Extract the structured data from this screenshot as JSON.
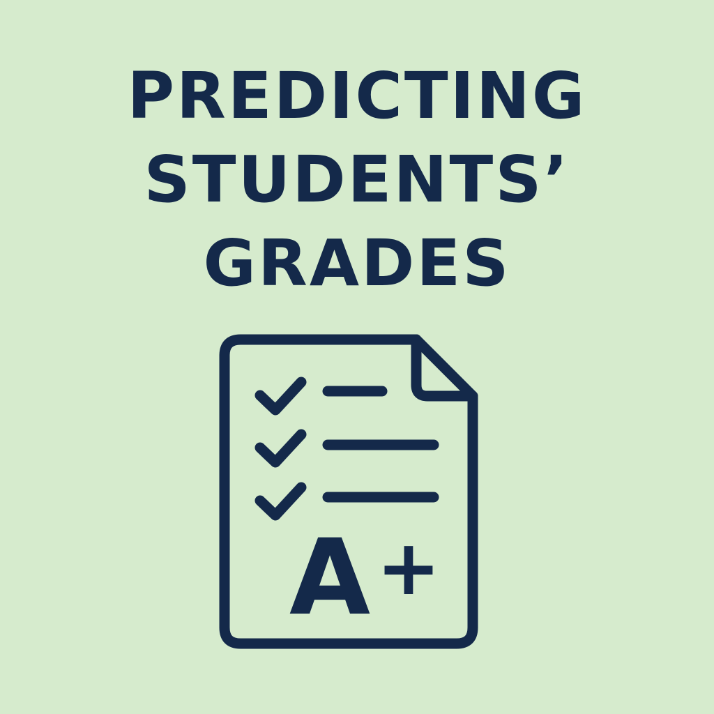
{
  "title": {
    "line1": "PREDICTING",
    "line2": "STUDENTS’",
    "line3": "GRADES"
  },
  "icon": {
    "name": "graded-test-document-icon",
    "checked_items": 3,
    "grade_letter": "A",
    "grade_modifier": "+"
  },
  "colors": {
    "background": "#d6ebcd",
    "ink": "#14294a"
  }
}
